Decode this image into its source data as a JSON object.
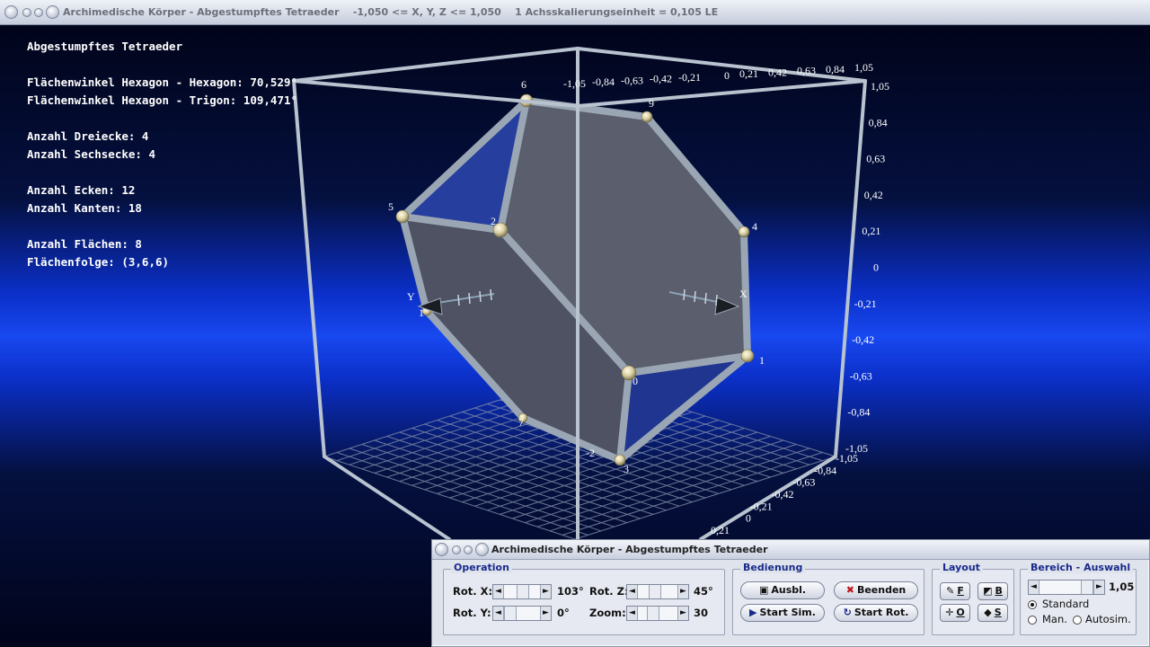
{
  "window": {
    "title": "Archimedische Körper - Abgestumpftes Tetraeder    -1,050 <= X, Y, Z <= 1,050    1 Achsskalierungseinheit = 0,105 LE"
  },
  "info": {
    "name": "Abgestumpftes Tetraeder",
    "angle_hh": "Flächenwinkel Hexagon - Hexagon: 70,529°",
    "angle_ht": "Flächenwinkel Hexagon - Trigon: 109,471°",
    "triangles": "Anzahl Dreiecke: 4",
    "hexagons": "Anzahl Sechsecke: 4",
    "vertices": "Anzahl Ecken: 12",
    "edges": "Anzahl Kanten: 18",
    "faces": "Anzahl Flächen: 8",
    "face_sequence": "Flächenfolge: (3,6,6)"
  },
  "scene": {
    "vertex_labels": [
      "6",
      "9",
      "5",
      "2",
      "4",
      "1",
      "1",
      "0",
      "3",
      "7",
      "-2"
    ],
    "axis_labels": [
      "X",
      "Y"
    ],
    "z_ticks": [
      "1,05",
      "0,84",
      "0,63",
      "0,42",
      "0,21",
      "0",
      "-0,21",
      "-0,42",
      "-0,63",
      "-0,84",
      "-1,05"
    ],
    "top_ticks": [
      "1,05",
      "0,84",
      "0,63",
      "0,42",
      "0,21",
      "0",
      "-0,21",
      "-0,42",
      "-0,63",
      "-0,84",
      "-1,05"
    ],
    "front_ticks": [
      "-1,05",
      "-0,84",
      "-0,63",
      "-0,42",
      "-0,21",
      "0",
      "0,21"
    ],
    "colors": {
      "bg_dark": "#01041a",
      "bg_band": "#0a2ed8",
      "face": "#585c6b",
      "face_blue": "#233a9e",
      "edge": "#9aa6b3",
      "frame": "#b8c3cf"
    }
  },
  "panel": {
    "title": "Archimedische Körper - Abgestumpftes Tetraeder",
    "operation": {
      "label": "Operation",
      "rot_x_label": "Rot. X:",
      "rot_x_value": "103°",
      "rot_y_label": "Rot. Y:",
      "rot_y_value": "0°",
      "rot_z_label": "Rot. Z:",
      "rot_z_value": "45°",
      "zoom_label": "Zoom:",
      "zoom_value": "30"
    },
    "bedienung": {
      "label": "Bedienung",
      "ausbl": "Ausbl.",
      "beenden": "Beenden",
      "start_sim": "Start Sim.",
      "start_rot": "Start Rot."
    },
    "layout": {
      "label": "Layout",
      "f": "F",
      "b": "B",
      "o": "O",
      "s": "S"
    },
    "bereich": {
      "label": "Bereich - Auswahl",
      "value": "1,05",
      "standard": "Standard",
      "man": "Man.",
      "autosim": "Autosim."
    }
  }
}
